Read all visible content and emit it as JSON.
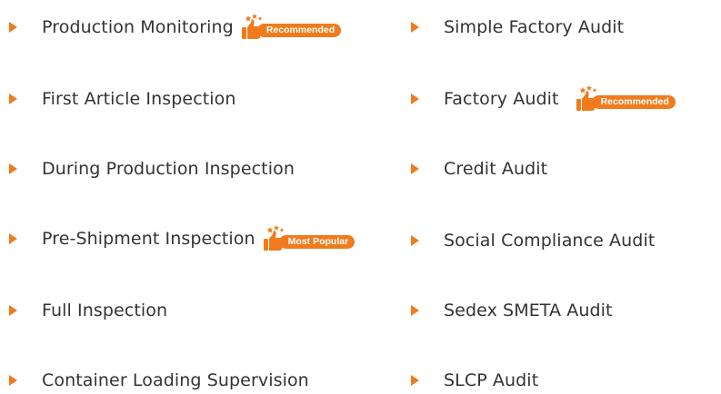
{
  "colors": {
    "accent": "#f07b1c",
    "text": "#333333"
  },
  "icons": {
    "bullet": "orange-triangle-arrow",
    "badge": "thumbs-up-with-stars"
  },
  "columns": {
    "left": [
      {
        "label": "Production Monitoring",
        "badge": "Recommended"
      },
      {
        "label": "First Article Inspection",
        "badge": ""
      },
      {
        "label": "During Production Inspection",
        "badge": ""
      },
      {
        "label": "Pre-Shipment Inspection",
        "badge": "Most Popular"
      },
      {
        "label": "Full Inspection",
        "badge": ""
      },
      {
        "label": "Container Loading Supervision",
        "badge": ""
      }
    ],
    "right": [
      {
        "label": "Simple Factory Audit",
        "badge": ""
      },
      {
        "label": "Factory Audit",
        "badge": "Recommended"
      },
      {
        "label": "Credit Audit",
        "badge": ""
      },
      {
        "label": "Social Compliance Audit",
        "badge": ""
      },
      {
        "label": "Sedex SMETA Audit",
        "badge": ""
      },
      {
        "label": "SLCP Audit",
        "badge": ""
      }
    ]
  }
}
